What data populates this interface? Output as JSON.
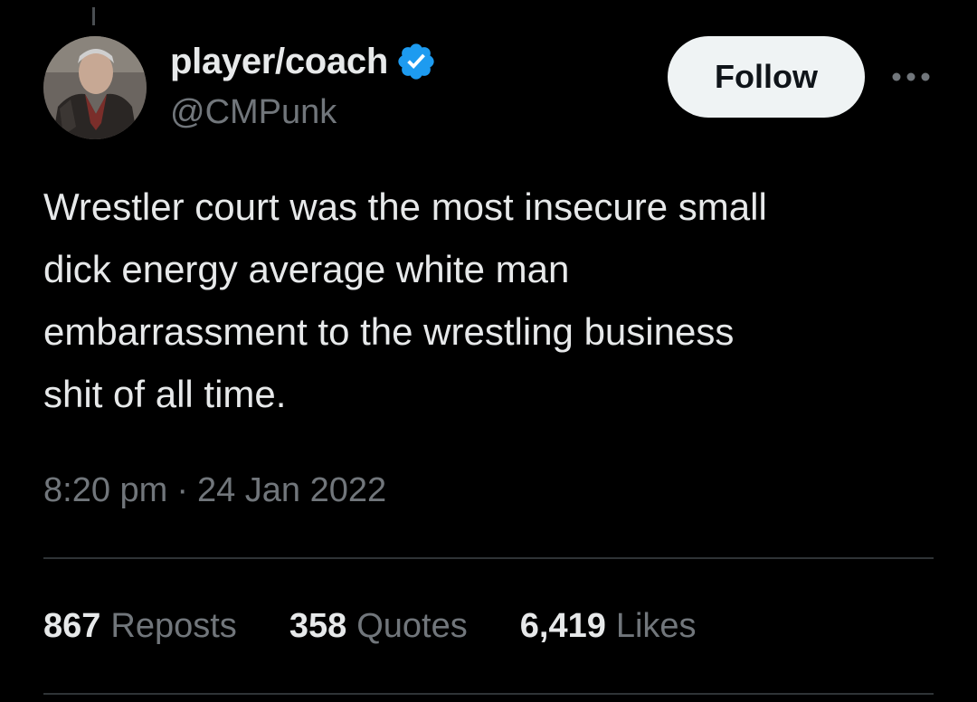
{
  "tweet": {
    "author": {
      "display_name": "player/coach",
      "handle": "@CMPunk",
      "verified_icon": "verified-badge-icon",
      "verified_color": "#1d9bf0"
    },
    "follow_label": "Follow",
    "more_icon": "more-horizontal-icon",
    "text": "Wrestler court was the most insecure small\ndick energy average white man\nembarrassment to the wrestling business\nshit of all time.",
    "time": "8:20 pm",
    "separator": "·",
    "date": "24 Jan 2022",
    "stats": [
      {
        "count": "867",
        "label": "Reposts"
      },
      {
        "count": "358",
        "label": "Quotes"
      },
      {
        "count": "6,419",
        "label": "Likes"
      }
    ]
  },
  "colors": {
    "background": "#000000",
    "text_primary": "#e7e9ea",
    "text_secondary": "#71767b",
    "follow_bg": "#eff3f4",
    "divider": "#2f3336"
  }
}
